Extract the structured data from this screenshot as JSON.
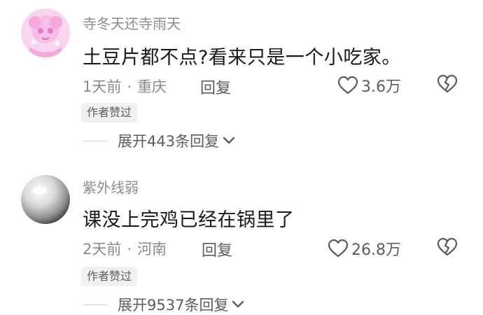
{
  "comments": [
    {
      "username": "寺冬天还寺雨天",
      "text": "土豆片都不点?看来只是一个小吃家。",
      "time": "1天前",
      "location": "重庆",
      "reply_label": "回复",
      "likes": "3.6万",
      "badge": "作者赞过",
      "expand_label": "展开443条回复",
      "avatar_icon": "pink-anime-avatar"
    },
    {
      "username": "紫外线弱",
      "text": "课没上完鸡已经在锅里了",
      "time": "2天前",
      "location": "河南",
      "reply_label": "回复",
      "likes": "26.8万",
      "badge": "作者赞过",
      "expand_label": "展开9537条回复",
      "avatar_icon": "silver-sphere-avatar"
    }
  ],
  "meta_separator": "·",
  "icons": {
    "like": "heart-outline-icon",
    "dislike": "broken-heart-icon",
    "expand": "chevron-down-icon"
  },
  "colors": {
    "text_primary": "#161823",
    "text_secondary": "#8a8b91",
    "badge_bg": "#f1f1f2",
    "avatar_pink": "#f6bde6"
  }
}
